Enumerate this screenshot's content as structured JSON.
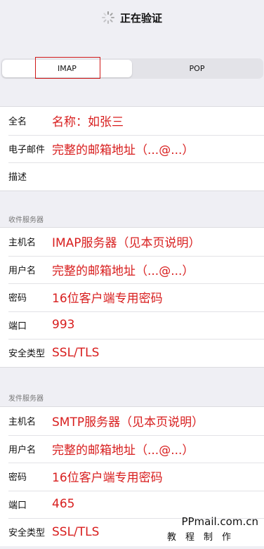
{
  "nav": {
    "title": "正在验证"
  },
  "tabs": [
    {
      "label": "IMAP",
      "active": true
    },
    {
      "label": "POP",
      "active": false
    }
  ],
  "account": {
    "fullname_label": "全名",
    "fullname_value": "名称：如张三",
    "email_label": "电子邮件",
    "email_value": "完整的邮箱地址（...@...）",
    "description_label": "描述",
    "description_value": ""
  },
  "incoming": {
    "header": "收件服务器",
    "host_label": "主机名",
    "host_value": "IMAP服务器（见本页说明）",
    "user_label": "用户名",
    "user_value": "完整的邮箱地址（...@...）",
    "password_label": "密码",
    "password_value": "16位客户端专用密码",
    "port_label": "端口",
    "port_value": "993",
    "security_label": "安全类型",
    "security_value": "SSL/TLS"
  },
  "outgoing": {
    "header": "发件服务器",
    "host_label": "主机名",
    "host_value": "SMTP服务器（见本页说明）",
    "user_label": "用户名",
    "user_value": "完整的邮箱地址（...@...）",
    "password_label": "密码",
    "password_value": "16位客户端专用密码",
    "port_label": "端口",
    "port_value": "465",
    "security_label": "安全类型",
    "security_value": "SSL/TLS"
  },
  "watermark": {
    "site": "PPmail.com.cn",
    "sub": "教程制作"
  },
  "colors": {
    "annotation_red": "#d81e1e",
    "highlight_box": "#d01818",
    "background": "#efeff4"
  },
  "icons": {
    "spinner": "loading-spinner-icon"
  }
}
